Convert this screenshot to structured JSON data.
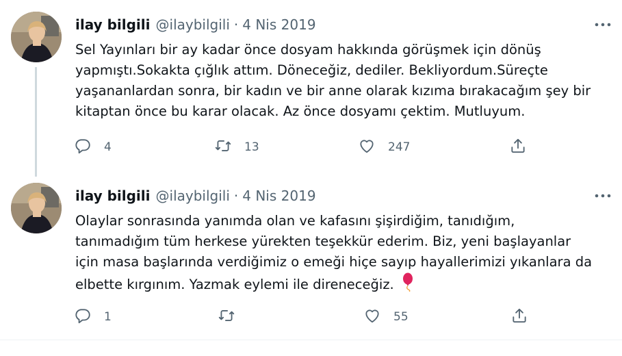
{
  "tweets": [
    {
      "name": "ilay bilgili",
      "handle": "@ilaybilgili",
      "separator": "·",
      "date": "4 Nis 2019",
      "text": "Sel Yayınları bir ay kadar önce dosyam hakkında görüşmek için dönüş\nyapmıştı.Sokakta çığlık attım. Döneceğiz, dediler. Bekliyordum.Süreçte\nyaşananlardan sonra, bir kadın ve bir anne olarak kızıma bırakacağım şey bir\nkitaptan önce bu karar olacak. Az önce dosyamı çektim. Mutluyum.",
      "replies": "4",
      "retweets": "13",
      "likes": "247"
    },
    {
      "name": "ilay bilgili",
      "handle": "@ilaybilgili",
      "separator": "·",
      "date": "4 Nis 2019",
      "text": "Olaylar sonrasında yanımda olan ve kafasını şişirdiğim, tanıdığım,\ntanımadığım tüm herkese yürekten teşekkür ederim. Biz, yeni başlayanlar\niçin masa başlarında verdiğimiz o emeği hiçe sayıp hayallerimizi yıkanlara da\nelbette kırgınım. Yazmak eylemi ile direneceğiz.",
      "replies": "1",
      "retweets": "",
      "likes": "55"
    }
  ],
  "icons": {
    "more": "more-dots-icon",
    "reply": "reply-icon",
    "retweet": "retweet-icon",
    "like": "heart-icon",
    "share": "share-icon",
    "emoji": "balloon-emoji"
  },
  "colors": {
    "text": "#0f1419",
    "muted": "#536471",
    "thread_line": "#cfd9de",
    "balloon": "#e0245e"
  }
}
